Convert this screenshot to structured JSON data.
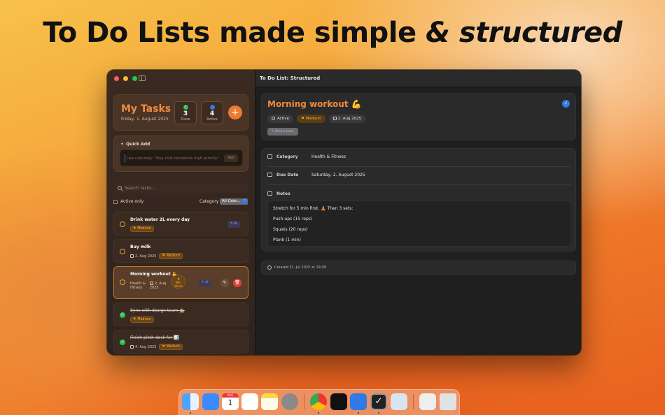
{
  "headline": {
    "plain": "To Do Lists made simple ",
    "italic": "& structured"
  },
  "sidebar": {
    "title": "My Tasks",
    "date": "Friday, 1. August 2025",
    "stats": {
      "done_count": "3",
      "done_label": "Done",
      "active_count": "4",
      "active_label": "Active"
    },
    "add_label": "+",
    "quick_add": {
      "title": "Quick Add",
      "placeholder": "Use naturally: \"Buy milk tomorrow high priority\"",
      "button": "Add"
    },
    "search_placeholder": "Search tasks...",
    "filter": {
      "active_only": "Active only",
      "category_label": "Category",
      "category_value": "All Cate..."
    }
  },
  "tasks": [
    {
      "title": "Drink water 2L every day",
      "priority": "Medium",
      "ai": "AI",
      "done": false
    },
    {
      "title": "Buy milk",
      "date": "2. Aug 2025",
      "priority": "Medium",
      "done": false
    },
    {
      "title": "Morning workout 💪",
      "category": "Health & Fitness",
      "date": "2. Aug 2025",
      "priority": "Me-dium",
      "ai": "AI",
      "done": false,
      "selected": true
    },
    {
      "title": "Sync with design team 🧑‍🎨",
      "priority": "Medium",
      "done": true
    },
    {
      "title": "Finish pitch deck for 📊",
      "date": "4. Aug 2025",
      "priority": "Medium",
      "done": true
    }
  ],
  "main": {
    "window_title": "To Do List: Structured",
    "detail": {
      "title": "Morning workout 💪",
      "status": "Active",
      "priority": "Medium",
      "due_short": "2. Aug 2025",
      "break_down": "Break down"
    },
    "info": {
      "category_label": "Category",
      "category_value": "Health & Fitness",
      "due_label": "Due Date",
      "due_value": "Saturday, 2. August 2025",
      "notes_label": "Notes",
      "notes": [
        "Stretch for 5 min first. 🧘 Then 3 sets:",
        "Push-ups (15 reps)",
        "Squats (20 reps)",
        "Plank (1 min)"
      ]
    },
    "created": "Created 31. Jul 2025 at 19:09"
  },
  "dock": {
    "apps": [
      "finder-icon",
      "mail-icon",
      "calendar-icon",
      "reminders-icon",
      "notes-icon",
      "settings-icon",
      "chrome-icon",
      "cube-app-icon",
      "xcode-icon",
      "todo-app-icon",
      "preview-icon",
      "window-icon",
      "trash-icon"
    ],
    "calendar_month": "AUG",
    "calendar_day": "1"
  },
  "colors": {
    "accent": "#f08a3c",
    "blue": "#2f7ae5",
    "done_green": "#31c04d",
    "delete_red": "#e4413b"
  }
}
